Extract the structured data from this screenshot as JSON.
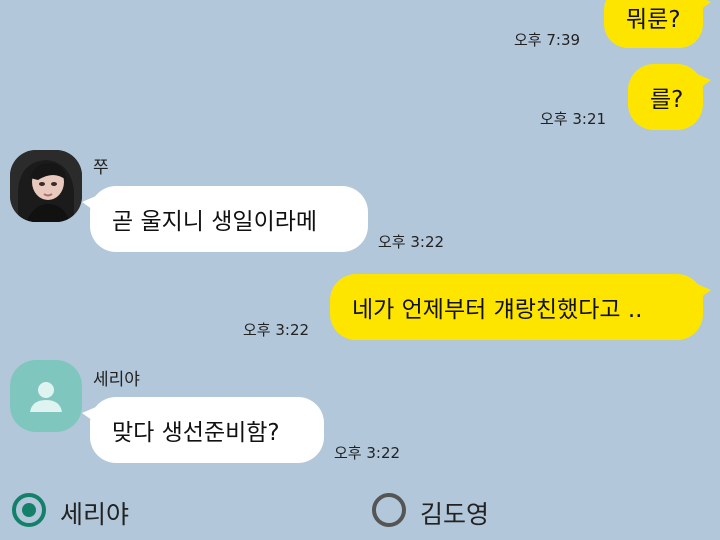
{
  "messages": [
    {
      "id": "m1",
      "side": "me",
      "text": "뭐룬?",
      "time": "오후 7:39"
    },
    {
      "id": "m2",
      "side": "me",
      "text": "를?",
      "time": "오후 3:21"
    },
    {
      "id": "m3",
      "side": "other",
      "sender": "쭈",
      "text": "곧 울지니 생일이라메",
      "time": "오후 3:22"
    },
    {
      "id": "m4",
      "side": "me",
      "text": "네가 언제부터 걔랑친했다고 ..",
      "time": "오후 3:22"
    },
    {
      "id": "m5",
      "side": "other",
      "sender": "세리야",
      "text": "맞다 생선준비함?",
      "time": "오후 3:22"
    }
  ],
  "choices": [
    {
      "label": "세리야",
      "selected": true
    },
    {
      "label": "김도영",
      "selected": false
    }
  ],
  "colors": {
    "background": "#b2c7da",
    "my_bubble": "#fee500",
    "other_bubble": "#ffffff",
    "radio_selected": "#15806a",
    "default_avatar": "#7fc6be"
  }
}
